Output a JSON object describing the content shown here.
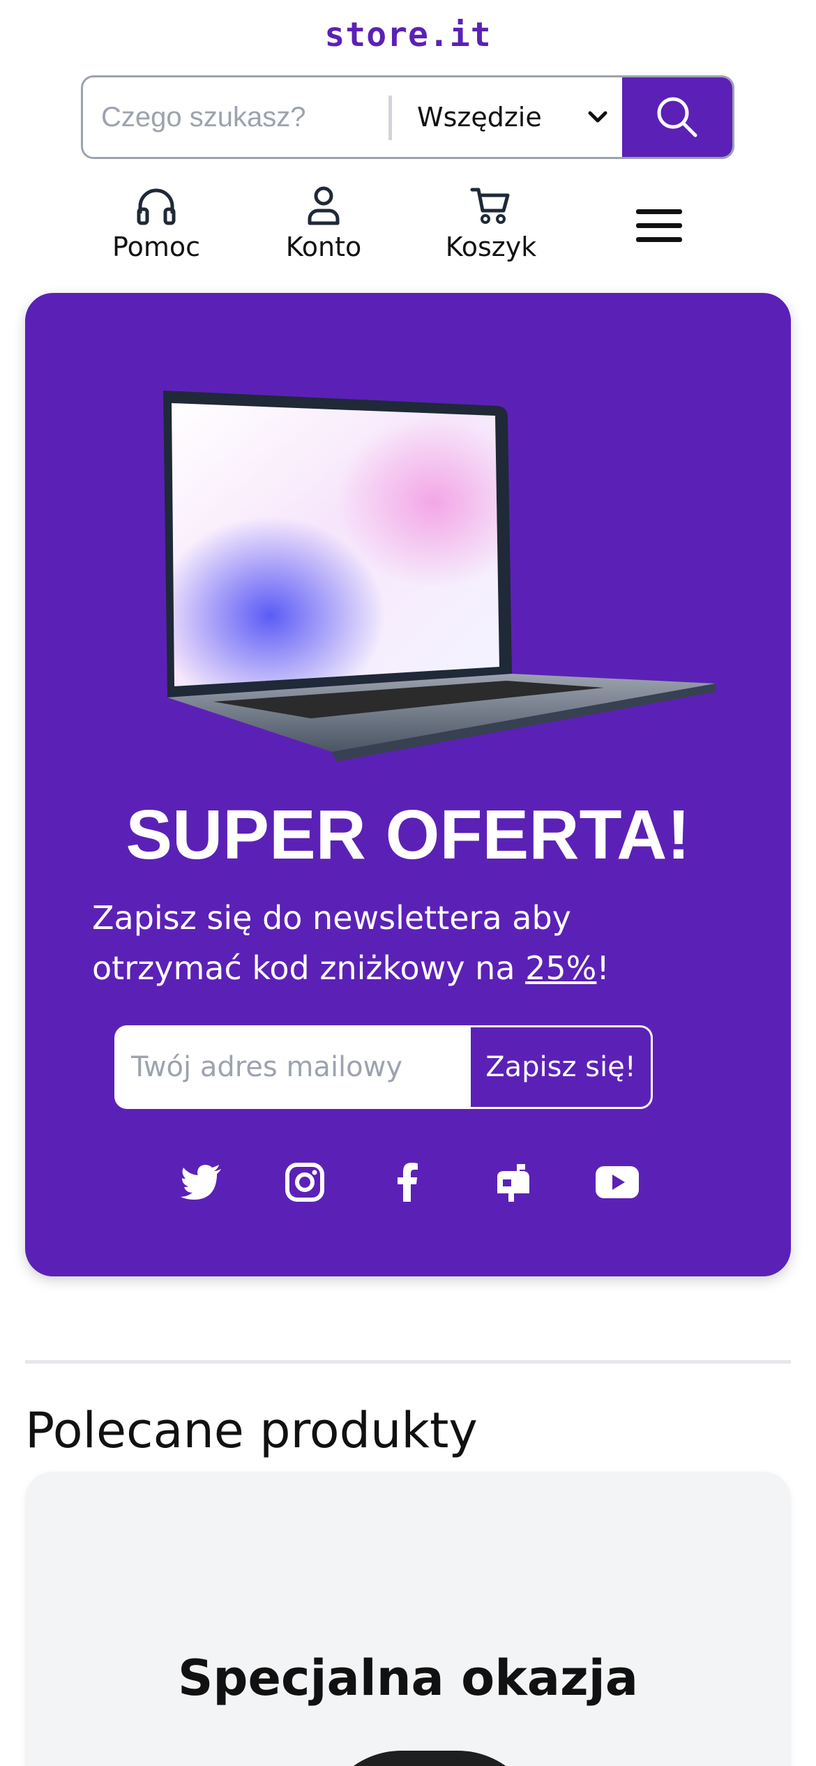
{
  "header": {
    "logo": "store.it"
  },
  "search": {
    "placeholder": "Czego szukasz?",
    "value": "",
    "scope": "Wszędzie"
  },
  "nav": {
    "items": [
      {
        "label": "Pomoc",
        "icon": "headphones-icon"
      },
      {
        "label": "Konto",
        "icon": "user-icon"
      },
      {
        "label": "Koszyk",
        "icon": "cart-icon"
      }
    ],
    "menu_icon": "hamburger-menu-icon"
  },
  "promo": {
    "title": "SUPER OFERTA!",
    "text_before": "Zapisz się do newslettera aby otrzymać kod zniżkowy na ",
    "discount": "25%",
    "text_after": "!",
    "email_placeholder": "Twój adres mailowy",
    "subscribe_label": "Zapisz się!",
    "socials": [
      "twitter-icon",
      "instagram-icon",
      "facebook-icon",
      "mailbox-icon",
      "youtube-icon"
    ]
  },
  "featured": {
    "title": "Polecane produkty",
    "card_title": "Specjalna okazja"
  },
  "colors": {
    "brand": "#5b21b6",
    "card_bg": "#f3f4f6",
    "text": "#111111"
  }
}
